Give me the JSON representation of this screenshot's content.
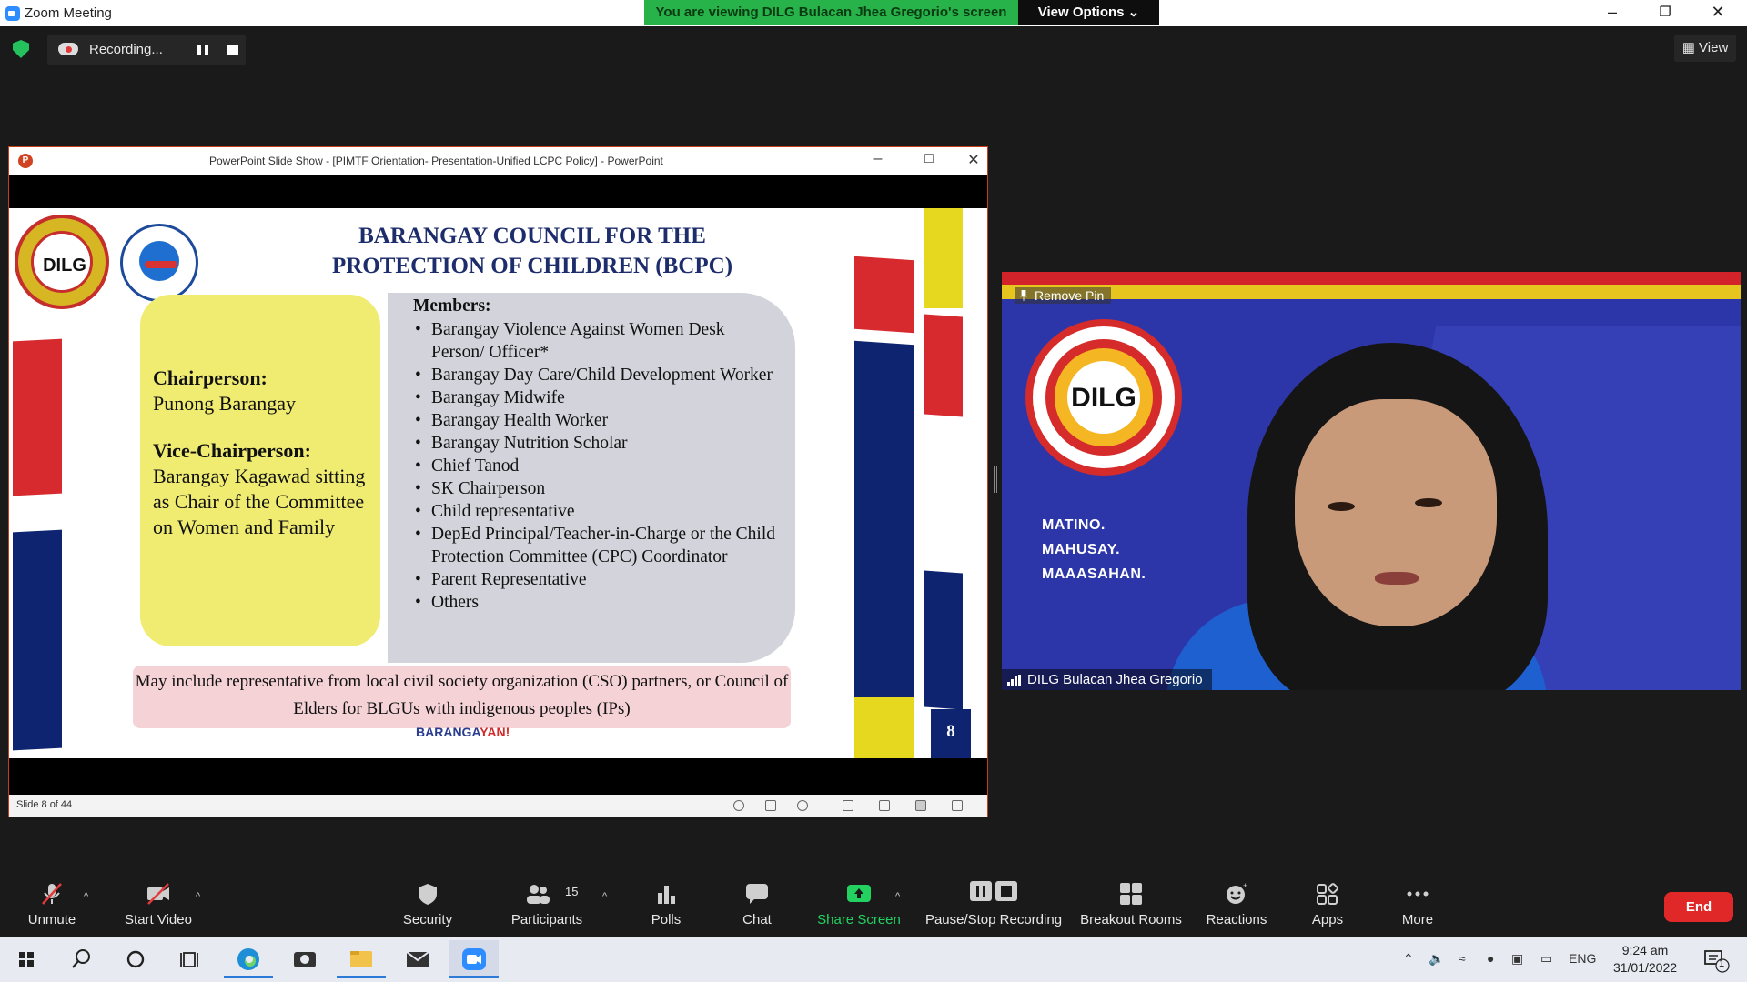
{
  "window": {
    "title": "Zoom Meeting"
  },
  "share_bar": {
    "viewing_text": "You are viewing DILG Bulacan Jhea Gregorio's screen",
    "view_options": "View Options"
  },
  "recording": {
    "label": "Recording..."
  },
  "view_button": {
    "label": "View"
  },
  "ppt": {
    "window_title": "PowerPoint Slide Show - [PIMTF Orientation- Presentation-Unified LCPC Policy] - PowerPoint",
    "status_slide": "Slide 8 of 44",
    "slide": {
      "logo_text": "DILG",
      "title_line1": "BARANGAY COUNCIL FOR THE",
      "title_line2": "PROTECTION OF CHILDREN (BCPC)",
      "chair_heading": "Chairperson:",
      "chair_value": "Punong Barangay",
      "vice_heading": "Vice-Chairperson:",
      "vice_value": "Barangay Kagawad sitting as Chair of the Committee on Women and Family",
      "members_heading": "Members:",
      "members": [
        "Barangay Violence Against Women Desk Person/ Officer*",
        "Barangay Day Care/Child Development Worker",
        "Barangay Midwife",
        "Barangay Health Worker",
        "Barangay Nutrition Scholar",
        "Chief Tanod",
        "SK Chairperson",
        "Child representative",
        "DepEd Principal/Teacher-in-Charge or the Child Protection Committee (CPC) Coordinator",
        "Parent Representative",
        "Others"
      ],
      "note": "May include representative from local civil society organization (CSO) partners, or Council of Elders for BLGUs with indigenous peoples (IPs)",
      "page_number": "8",
      "footer_brand_a": "BARANGA",
      "footer_brand_b": "Y",
      "footer_brand_c": "AN!"
    }
  },
  "video": {
    "remove_pin": "Remove Pin",
    "logo_text": "DILG",
    "slogan": [
      "MATINO.",
      "MAHUSAY.",
      "MAAASAHAN."
    ],
    "participant_name": "DILG Bulacan Jhea Gregorio"
  },
  "toolbar": {
    "unmute": "Unmute",
    "start_video": "Start Video",
    "security": "Security",
    "participants": "Participants",
    "participants_count": "15",
    "polls": "Polls",
    "chat": "Chat",
    "share_screen": "Share Screen",
    "pause_stop_recording": "Pause/Stop Recording",
    "breakout_rooms": "Breakout Rooms",
    "reactions": "Reactions",
    "apps": "Apps",
    "more": "More",
    "end": "End"
  },
  "taskbar": {
    "language": "ENG",
    "time": "9:24 am",
    "date": "31/01/2022",
    "notification_count": "1"
  },
  "colors": {
    "zoom_green": "#27b24a",
    "end_red": "#e02828",
    "slide_navy": "#1d2d6b"
  }
}
